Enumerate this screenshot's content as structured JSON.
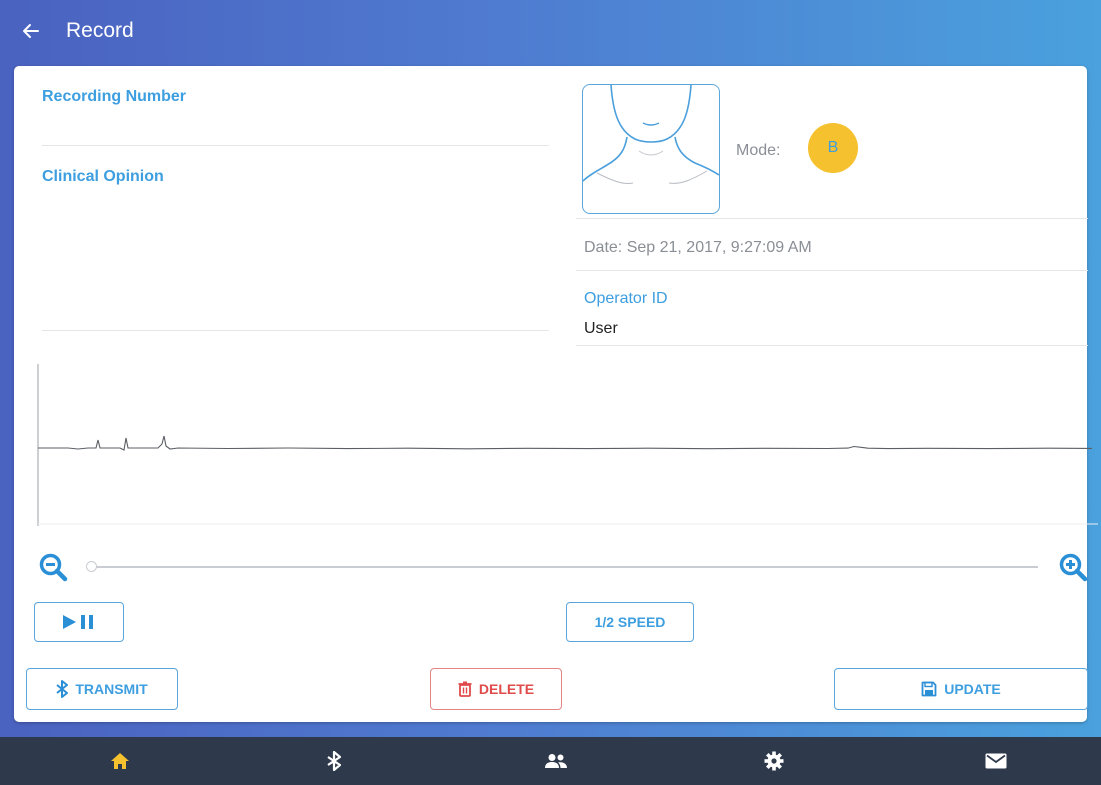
{
  "header": {
    "title": "Record",
    "back_icon": "arrow-left-icon"
  },
  "form": {
    "recording_number_label": "Recording Number",
    "recording_number_value": "",
    "clinical_opinion_label": "Clinical Opinion",
    "clinical_opinion_value": "",
    "mode_label": "Mode:",
    "mode_value": "B",
    "date_text": "Date: Sep 21, 2017, 9:27:09 AM",
    "operator_label": "Operator ID",
    "operator_value": "User"
  },
  "playback": {
    "zoom_out_icon": "zoom-out-icon",
    "zoom_in_icon": "zoom-in-icon",
    "zoom_level": 0,
    "play_pause_icon": "play-pause-icon",
    "speed_label": "1/2 SPEED"
  },
  "actions": {
    "transmit_label": "TRANSMIT",
    "delete_label": "DELETE",
    "update_label": "UPDATE"
  },
  "bottom_nav": {
    "items": [
      {
        "icon": "home-icon",
        "active": true
      },
      {
        "icon": "bluetooth-icon",
        "active": false
      },
      {
        "icon": "users-icon",
        "active": false
      },
      {
        "icon": "settings-icon",
        "active": false
      },
      {
        "icon": "mail-icon",
        "active": false
      }
    ]
  },
  "colors": {
    "accent": "#3d9ee0",
    "mode_badge": "#f5c12e",
    "delete": "#e04b4b",
    "nav_active": "#f5c12e",
    "nav_bg": "#2e3a4c"
  }
}
